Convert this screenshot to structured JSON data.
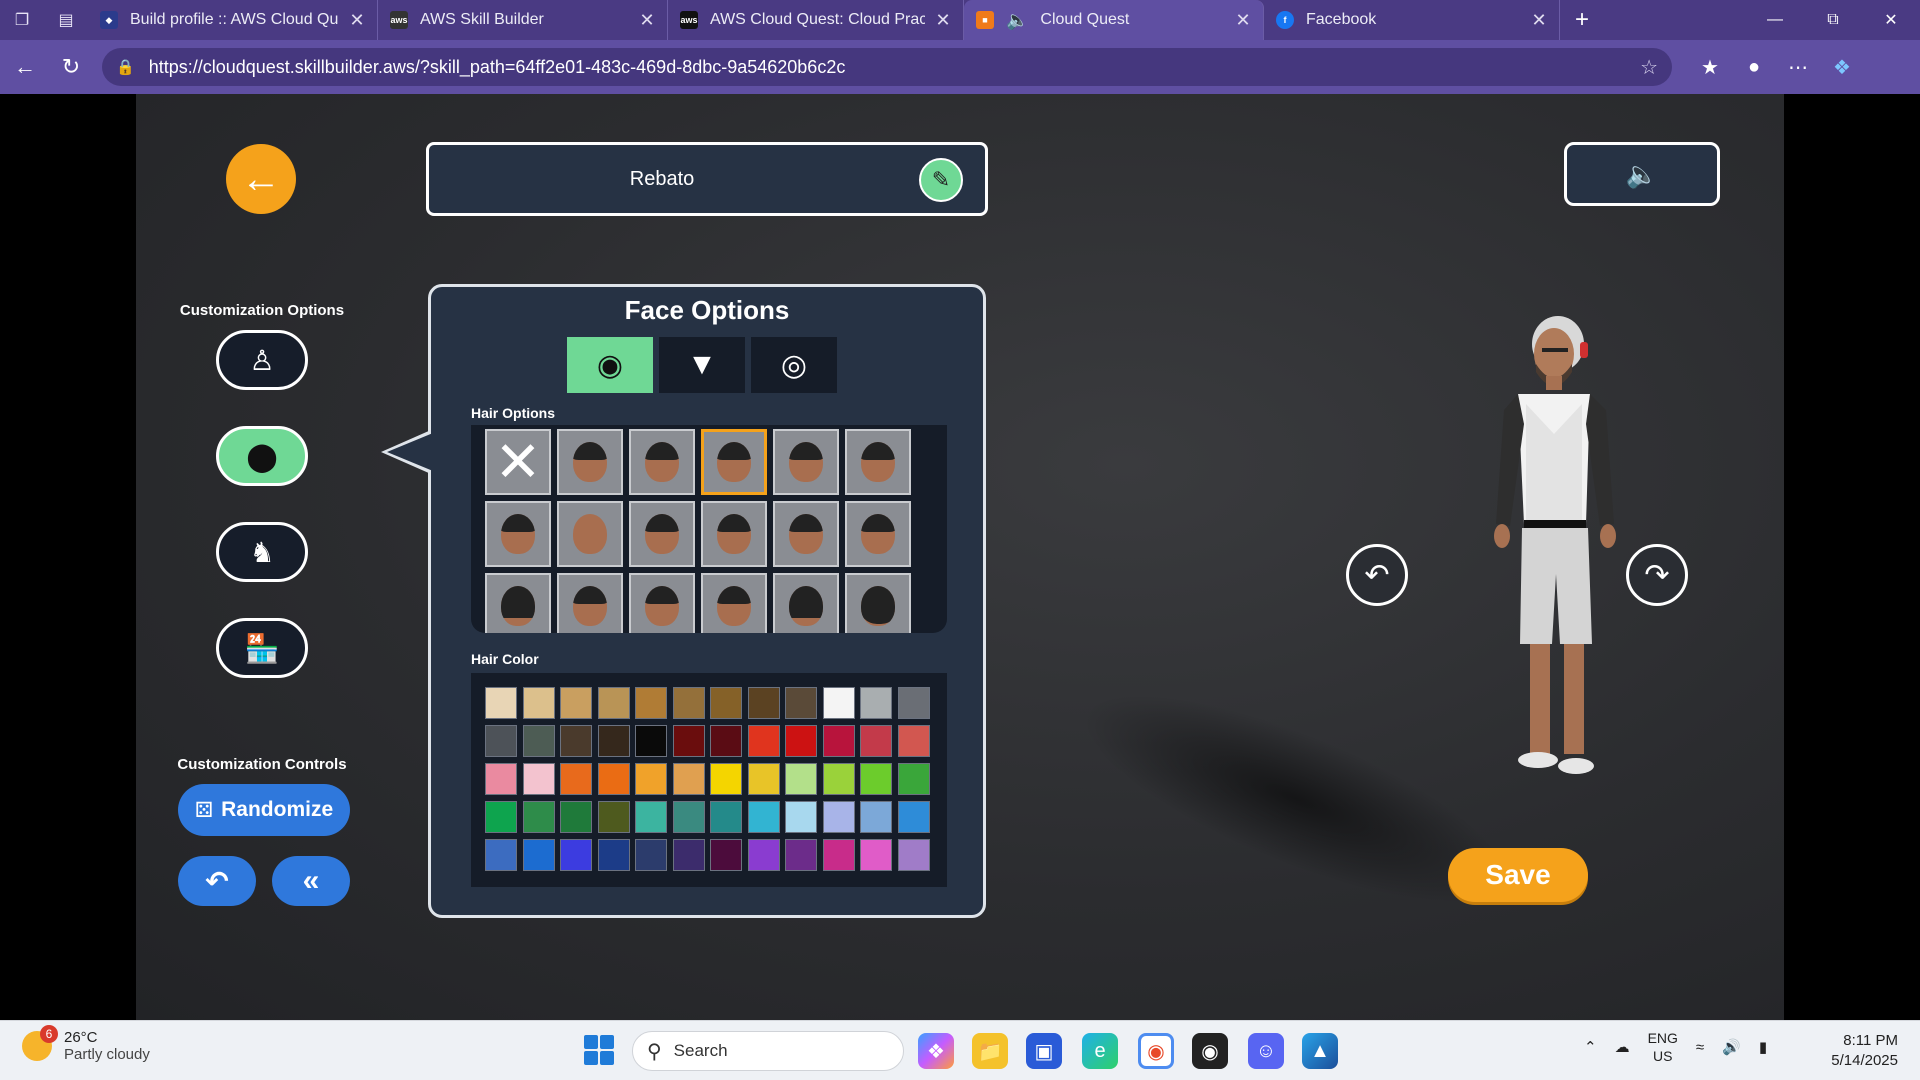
{
  "browser": {
    "tabs": [
      {
        "title": "Build profile :: AWS Cloud Quest: C",
        "active": false
      },
      {
        "title": "AWS Skill Builder",
        "active": false
      },
      {
        "title": "AWS Cloud Quest: Cloud Practitio",
        "active": false
      },
      {
        "title": "Cloud Quest",
        "active": true
      },
      {
        "title": "Facebook",
        "active": false
      }
    ],
    "url": "https://cloudquest.skillbuilder.aws/?skill_path=64ff2e01-483c-469d-8dbc-9a54620b6c2c"
  },
  "game": {
    "player_name": "Rebato",
    "customization_options_title": "Customization Options",
    "customization_controls_title": "Customization Controls",
    "randomize_label": "Randomize",
    "face_options_title": "Face Options",
    "hair_options_label": "Hair Options",
    "hair_color_label": "Hair Color",
    "save_label": "Save",
    "hair_styles": [
      "none",
      "short",
      "short",
      "short",
      "short",
      "short",
      "short",
      "bald",
      "short",
      "short",
      "short",
      "short",
      "long",
      "short",
      "short",
      "short",
      "long",
      "afro"
    ],
    "selected_hair_index": 3,
    "hair_colors": [
      "#e8d5b5",
      "#dcc08c",
      "#c99f60",
      "#b99456",
      "#b07c35",
      "#94703a",
      "#856128",
      "#5b4222",
      "#5a4a38",
      "#f4f4f4",
      "#a9aeb0",
      "#6a6e75",
      "#4d5258",
      "#4d5c54",
      "#4a3a2c",
      "#35281c",
      "#0a0a0a",
      "#6a0d0d",
      "#5a0c14",
      "#e0341e",
      "#cc1212",
      "#b8143c",
      "#c33a4a",
      "#d25750",
      "#ea8aa0",
      "#f3c3cf",
      "#e86a1c",
      "#ea6c14",
      "#f0a22a",
      "#e0a050",
      "#f4d500",
      "#e8c428",
      "#b3e08a",
      "#9ad23a",
      "#6ccc2c",
      "#3aa63a",
      "#0ea44e",
      "#2e8c4a",
      "#1f7a3a",
      "#4e5a1e",
      "#3cb4a0",
      "#3a8a80",
      "#248a8a",
      "#32b4d2",
      "#a8d8ee",
      "#a8b4e8",
      "#7ca8d8",
      "#2e8cd8",
      "#3c6cc0",
      "#1c6cd0",
      "#3c3ce0",
      "#1c3c88",
      "#2c3c6c",
      "#3c2c6c",
      "#4c0c3c",
      "#8a3cd0",
      "#6c2c8a",
      "#c82c8a",
      "#e05cc8",
      "#a07cc8"
    ]
  },
  "taskbar": {
    "weather_temp": "26°C",
    "weather_desc": "Partly cloudy",
    "weather_badge": "6",
    "search_placeholder": "Search",
    "lang_top": "ENG",
    "lang_bottom": "US",
    "time": "8:11 PM",
    "date": "5/14/2025"
  }
}
